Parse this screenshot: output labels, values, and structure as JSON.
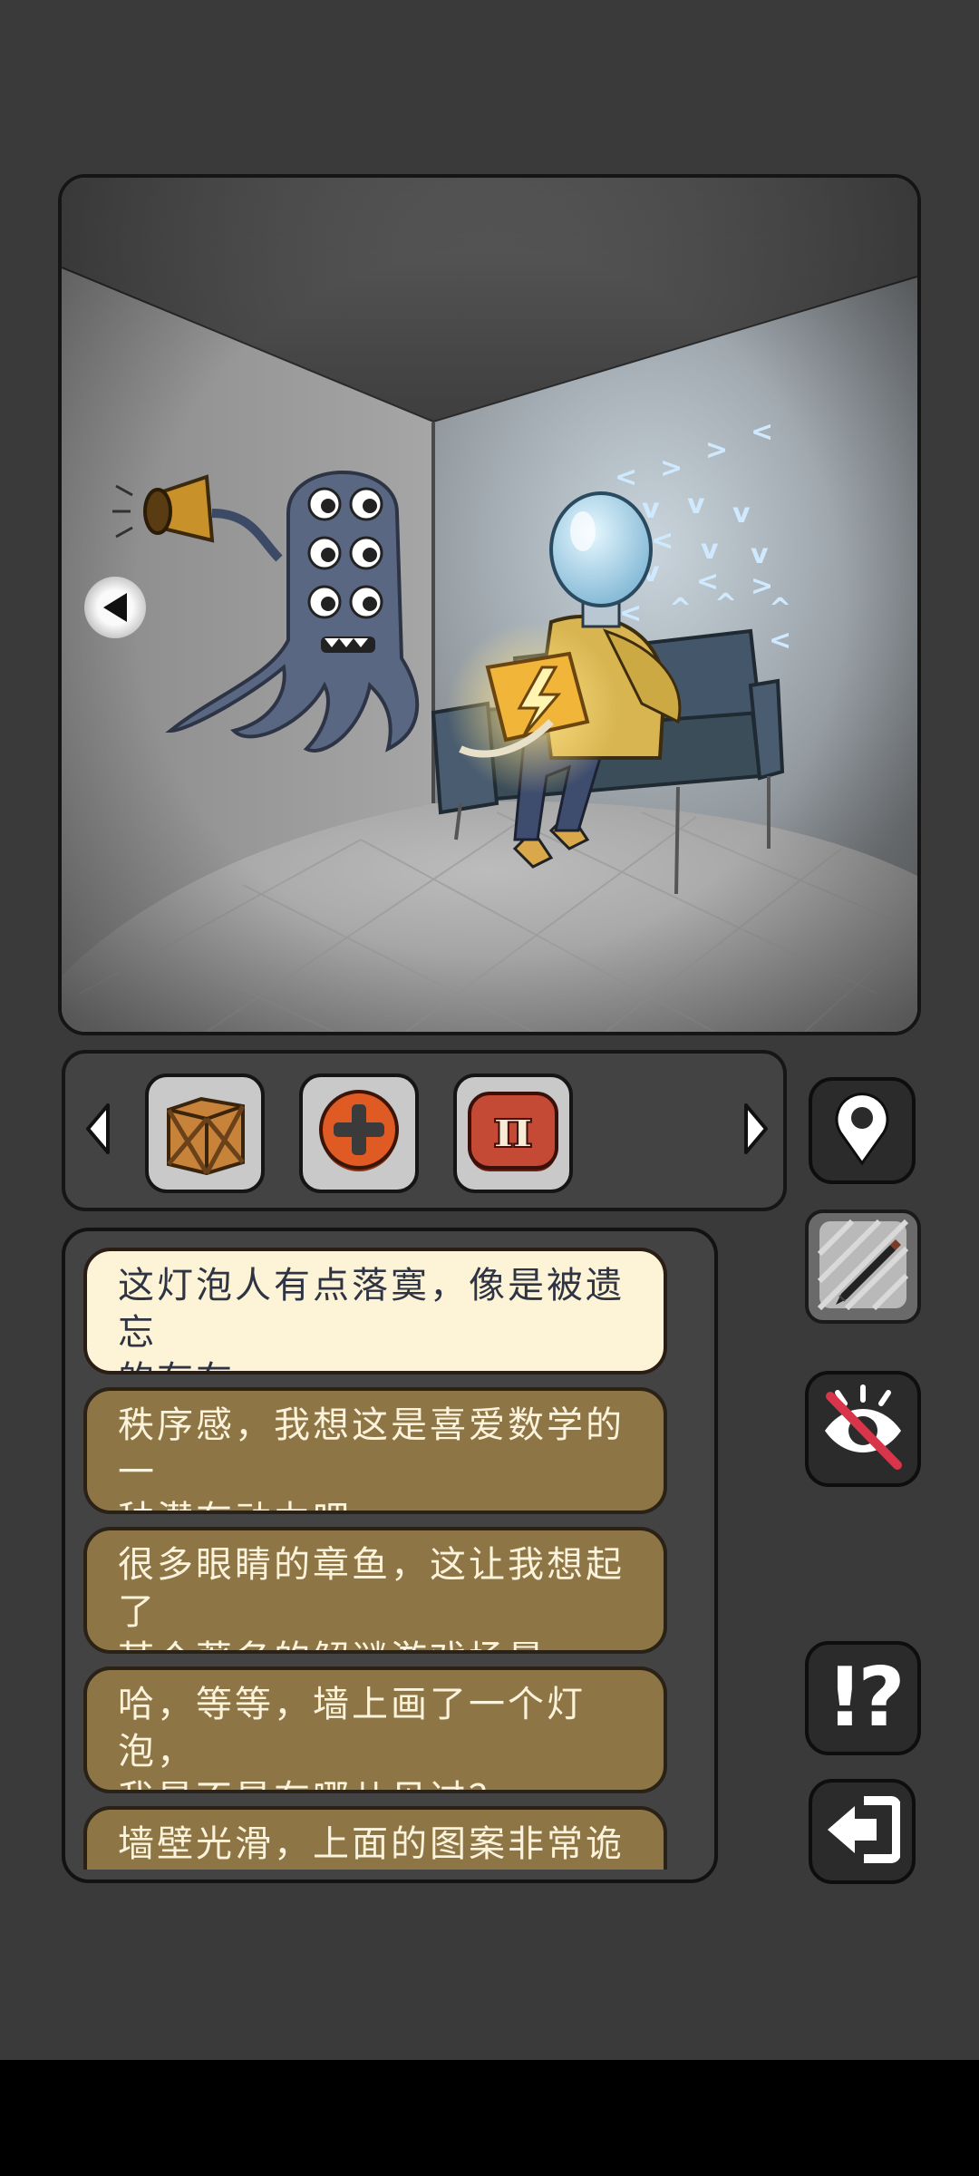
{
  "scene": {
    "caption": "",
    "wall_arrows": [
      "<",
      ">",
      ">",
      "<",
      "<",
      "v",
      "v",
      "v",
      ">",
      "<",
      "v",
      "v",
      "v",
      "v",
      "<",
      ">",
      "<",
      "^",
      "^",
      "^",
      "<"
    ]
  },
  "navigation": {
    "scene_left_arrow_icon": "left-triangle"
  },
  "inventory": {
    "left_arrow_icon": "left-triangle",
    "right_arrow_icon": "right-triangle",
    "items": [
      {
        "name": "wooden-crate",
        "icon": "crate"
      },
      {
        "name": "plus-button",
        "icon": "plus"
      },
      {
        "name": "pi-badge",
        "icon": "pi",
        "symbol": "π"
      }
    ]
  },
  "sidebar_buttons": {
    "map": {
      "icon": "map-pin-icon"
    },
    "notes": {
      "icon": "pencil-icon"
    },
    "hide_view": {
      "icon": "eye-slash-icon"
    },
    "hint": {
      "icon": "hint-icon",
      "symbol": "!?"
    },
    "exit": {
      "icon": "exit-icon"
    }
  },
  "dialog": {
    "options": [
      {
        "line1": "这灯泡人有点落寞，像是被遗忘",
        "line2": "的存在。",
        "selected": true
      },
      {
        "line1": "秩序感，我想这是喜爱数学的一",
        "line2": "种潜在动力吧。",
        "selected": false
      },
      {
        "line1": "很多眼睛的章鱼，这让我想起了",
        "line2": "某个著名的解谜游戏场景。",
        "selected": false
      },
      {
        "line1": "哈，等等，墙上画了一个灯泡，",
        "line2": "我是不是在哪儿见过？",
        "selected": false
      },
      {
        "line1": "墙壁光滑，上面的图案非常诡",
        "line2": "",
        "selected": false
      }
    ]
  },
  "colors": {
    "background": "#3a3a3a",
    "option_fill": "#8e7545",
    "option_selected_fill": "#fdf4d7",
    "hide_slash": "#d8344a"
  }
}
